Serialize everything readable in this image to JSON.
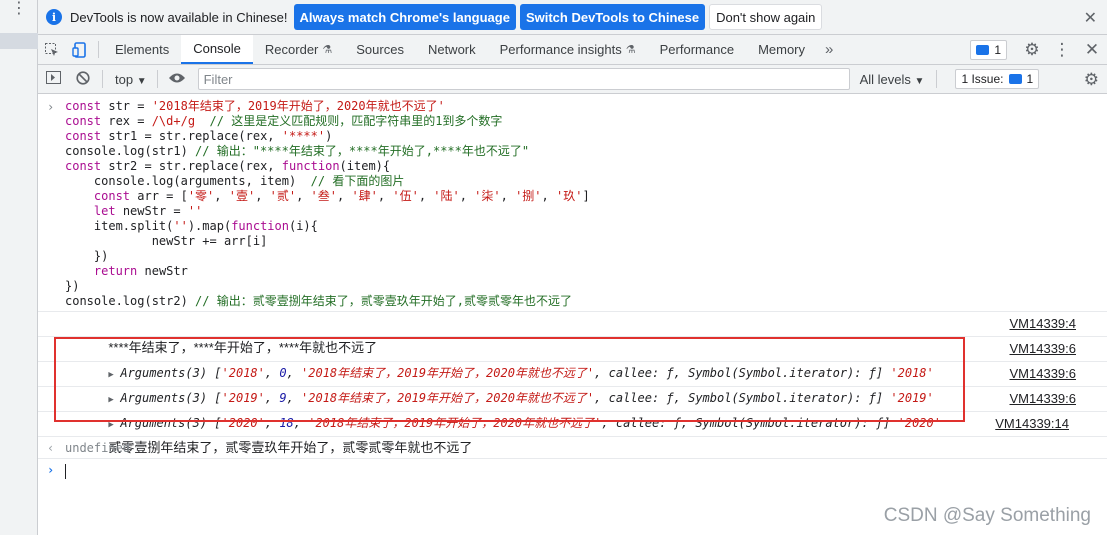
{
  "infobar": {
    "message": "DevTools is now available in Chinese!",
    "btn_match": "Always match Chrome's language",
    "btn_switch": "Switch DevTools to Chinese",
    "btn_dont_show": "Don't show again",
    "close": "✕"
  },
  "tabs": [
    {
      "label": "Elements"
    },
    {
      "label": "Console"
    },
    {
      "label": "Recorder"
    },
    {
      "label": "Sources"
    },
    {
      "label": "Network"
    },
    {
      "label": "Performance insights"
    },
    {
      "label": "Performance"
    },
    {
      "label": "Memory"
    }
  ],
  "tabbar_right": {
    "overflow": "»",
    "messages_count": "1",
    "gear": "⚙",
    "more": "⋮",
    "close": "✕"
  },
  "toolbar": {
    "context": "top",
    "filter_placeholder": "Filter",
    "levels": "All levels",
    "issues_label": "1 Issue:",
    "issues_count": "1"
  },
  "code_lines": [
    "const str = '2018年结束了，2019年开始了，2020年就也不远了'",
    "const rex = /\\d+/g  // 这里是定义匹配规则，匹配字符串里的1到多个数字",
    "const str1 = str.replace(rex, '****')",
    "console.log(str1) // 输出：\"****年结束了，****年开始了,****年也不远了\"",
    "const str2 = str.replace(rex, function(item){",
    "    console.log(arguments, item)  // 看下面的图片",
    "    const arr = ['零', '壹', '贰', '叁', '肆', '伍', '陆', '柒', '捌', '玖']",
    "    let newStr = ''",
    "    item.split('').map(function(i){",
    "            newStr += arr[i]",
    "    })",
    "    return newStr",
    "})",
    "console.log(str2) // 输出：贰零壹捌年结束了，贰零壹玖年开始了,贰零贰零年也不远了"
  ],
  "logs": {
    "str1_text": "****年结束了，****年开始了，****年就也不远了",
    "str1_src": "VM14339:4",
    "args": [
      {
        "prefix": "Arguments(3) [",
        "match": "'2018'",
        "offset": "0",
        "full": "'2018年结束了，2019年开始了，2020年就也不远了'",
        "tail": "callee: ƒ, Symbol(Symbol.iterator): ƒ]",
        "item": "'2018'",
        "src": "VM14339:6"
      },
      {
        "prefix": "Arguments(3) [",
        "match": "'2019'",
        "offset": "9",
        "full": "'2018年结束了，2019年开始了，2020年就也不远了'",
        "tail": "callee: ƒ, Symbol(Symbol.iterator): ƒ]",
        "item": "'2019'",
        "src": "VM14339:6"
      },
      {
        "prefix": "Arguments(3) [",
        "match": "'2020'",
        "offset": "18",
        "full": "'2018年结束了，2019年开始了，2020年就也不远了'",
        "tail": "callee: ƒ, Symbol(Symbol.iterator): ƒ]",
        "item": "'2020'",
        "src": "VM14339:6"
      }
    ],
    "str2_text": "贰零壹捌年结束了，贰零壹玖年开始了，贰零贰零年就也不远了",
    "str2_src": "VM14339:14",
    "undefined_text": "undefined"
  },
  "watermark": "CSDN @Say   Something",
  "colors": {
    "accent": "#1a73e8",
    "highlight": "#e0312e"
  }
}
